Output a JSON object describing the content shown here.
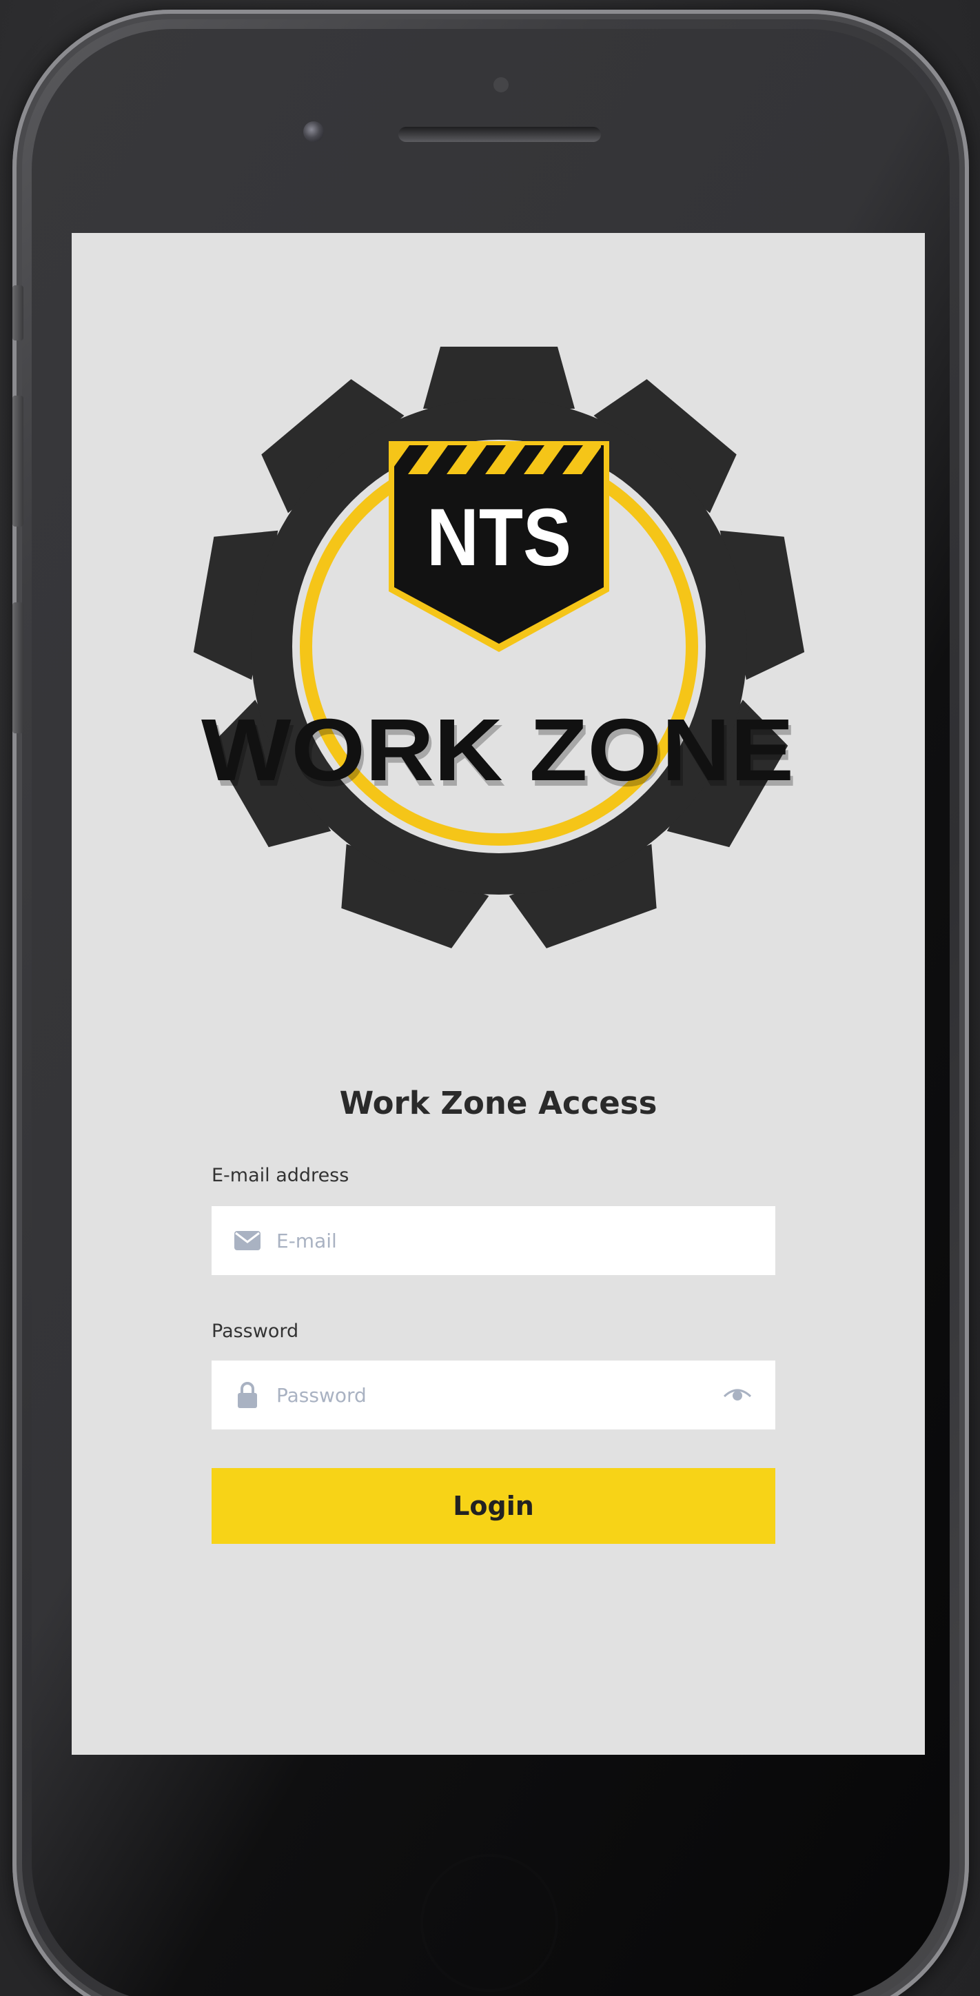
{
  "logo": {
    "badge_text": "NTS",
    "wordmark": "WORK ZONE"
  },
  "screen": {
    "title": "Work Zone Access",
    "email": {
      "label": "E-mail address",
      "placeholder": "E-mail",
      "value": "",
      "icon": "envelope-icon"
    },
    "password": {
      "label": "Password",
      "placeholder": "Password",
      "value": "",
      "icon": "lock-icon",
      "toggle_icon": "eye-icon"
    },
    "login_label": "Login"
  },
  "colors": {
    "screen_bg": "#e1e1e1",
    "accent_yellow": "#f7d317",
    "gear": "#2b2b2b",
    "icon_muted": "#a9b2c2"
  }
}
